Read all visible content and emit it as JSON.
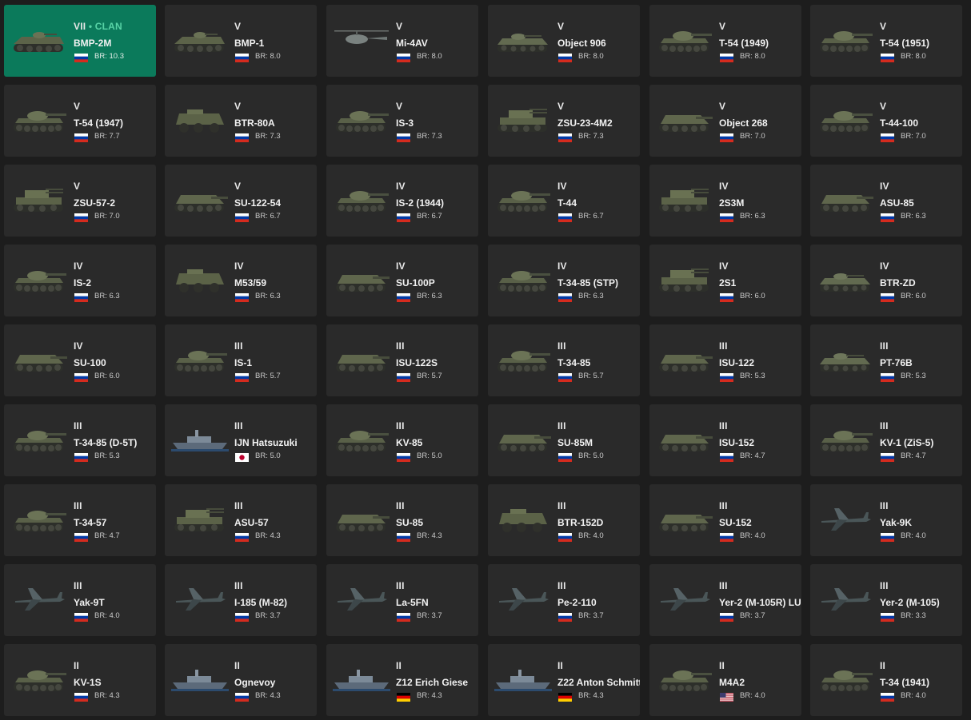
{
  "br_prefix": "BR:",
  "colors": {
    "card_bg": "#2a2a2a",
    "highlight_bg": "#0b7a5b",
    "clan_accent": "#58d3a6",
    "page_bg": "#1d1d1d"
  },
  "vehicles": [
    {
      "rank": "VII",
      "clan_label": "CLAN",
      "name": "BMP-2M",
      "nation": "ussr",
      "br": "10.3",
      "type": "ifv",
      "highlight": true
    },
    {
      "rank": "V",
      "name": "BMP-1",
      "nation": "ussr",
      "br": "8.0",
      "type": "ifv"
    },
    {
      "rank": "V",
      "name": "Mi-4AV",
      "nation": "ussr",
      "br": "8.0",
      "type": "heli"
    },
    {
      "rank": "V",
      "name": "Object 906",
      "nation": "ussr",
      "br": "8.0",
      "type": "light"
    },
    {
      "rank": "V",
      "name": "T-54 (1949)",
      "nation": "ussr",
      "br": "8.0",
      "type": "tank"
    },
    {
      "rank": "V",
      "name": "T-54 (1951)",
      "nation": "ussr",
      "br": "8.0",
      "type": "tank"
    },
    {
      "rank": "V",
      "name": "T-54 (1947)",
      "nation": "ussr",
      "br": "7.7",
      "type": "tank"
    },
    {
      "rank": "V",
      "name": "BTR-80A",
      "nation": "ussr",
      "br": "7.3",
      "type": "wheeled"
    },
    {
      "rank": "V",
      "name": "IS-3",
      "nation": "ussr",
      "br": "7.3",
      "type": "tank"
    },
    {
      "rank": "V",
      "name": "ZSU-23-4M2",
      "nation": "ussr",
      "br": "7.3",
      "type": "spaa"
    },
    {
      "rank": "V",
      "name": "Object 268",
      "nation": "ussr",
      "br": "7.0",
      "type": "td"
    },
    {
      "rank": "V",
      "name": "T-44-100",
      "nation": "ussr",
      "br": "7.0",
      "type": "tank"
    },
    {
      "rank": "V",
      "name": "ZSU-57-2",
      "nation": "ussr",
      "br": "7.0",
      "type": "spaa"
    },
    {
      "rank": "V",
      "name": "SU-122-54",
      "nation": "ussr",
      "br": "6.7",
      "type": "td"
    },
    {
      "rank": "IV",
      "name": "IS-2 (1944)",
      "nation": "ussr",
      "br": "6.7",
      "type": "tank"
    },
    {
      "rank": "IV",
      "name": "T-44",
      "nation": "ussr",
      "br": "6.7",
      "type": "tank"
    },
    {
      "rank": "IV",
      "name": "2S3M",
      "nation": "ussr",
      "br": "6.3",
      "type": "spaa"
    },
    {
      "rank": "IV",
      "name": "ASU-85",
      "nation": "ussr",
      "br": "6.3",
      "type": "td"
    },
    {
      "rank": "IV",
      "name": "IS-2",
      "nation": "ussr",
      "br": "6.3",
      "type": "tank"
    },
    {
      "rank": "IV",
      "name": "M53/59",
      "nation": "ussr",
      "br": "6.3",
      "type": "wheeled"
    },
    {
      "rank": "IV",
      "name": "SU-100P",
      "nation": "ussr",
      "br": "6.3",
      "type": "td"
    },
    {
      "rank": "IV",
      "name": "T-34-85 (STP)",
      "nation": "ussr",
      "br": "6.3",
      "type": "tank"
    },
    {
      "rank": "IV",
      "name": "2S1",
      "nation": "ussr",
      "br": "6.0",
      "type": "spaa"
    },
    {
      "rank": "IV",
      "name": "BTR-ZD",
      "nation": "ussr",
      "br": "6.0",
      "type": "light"
    },
    {
      "rank": "IV",
      "name": "SU-100",
      "nation": "ussr",
      "br": "6.0",
      "type": "td"
    },
    {
      "rank": "III",
      "name": "IS-1",
      "nation": "ussr",
      "br": "5.7",
      "type": "tank"
    },
    {
      "rank": "III",
      "name": "ISU-122S",
      "nation": "ussr",
      "br": "5.7",
      "type": "td"
    },
    {
      "rank": "III",
      "name": "T-34-85",
      "nation": "ussr",
      "br": "5.7",
      "type": "tank"
    },
    {
      "rank": "III",
      "name": "ISU-122",
      "nation": "ussr",
      "br": "5.3",
      "type": "td"
    },
    {
      "rank": "III",
      "name": "PT-76B",
      "nation": "ussr",
      "br": "5.3",
      "type": "light"
    },
    {
      "rank": "III",
      "name": "T-34-85 (D-5T)",
      "nation": "ussr",
      "br": "5.3",
      "type": "tank"
    },
    {
      "rank": "III",
      "name": "IJN Hatsuzuki",
      "nation": "japan",
      "br": "5.0",
      "type": "ship"
    },
    {
      "rank": "III",
      "name": "KV-85",
      "nation": "ussr",
      "br": "5.0",
      "type": "tank"
    },
    {
      "rank": "III",
      "name": "SU-85M",
      "nation": "ussr",
      "br": "5.0",
      "type": "td"
    },
    {
      "rank": "III",
      "name": "ISU-152",
      "nation": "ussr",
      "br": "4.7",
      "type": "td"
    },
    {
      "rank": "III",
      "name": "KV-1 (ZiS-5)",
      "nation": "ussr",
      "br": "4.7",
      "type": "tank"
    },
    {
      "rank": "III",
      "name": "T-34-57",
      "nation": "ussr",
      "br": "4.7",
      "type": "tank"
    },
    {
      "rank": "III",
      "name": "ASU-57",
      "nation": "ussr",
      "br": "4.3",
      "type": "spaa"
    },
    {
      "rank": "III",
      "name": "SU-85",
      "nation": "ussr",
      "br": "4.3",
      "type": "td"
    },
    {
      "rank": "III",
      "name": "BTR-152D",
      "nation": "ussr",
      "br": "4.0",
      "type": "wheeled"
    },
    {
      "rank": "III",
      "name": "SU-152",
      "nation": "ussr",
      "br": "4.0",
      "type": "td"
    },
    {
      "rank": "III",
      "name": "Yak-9K",
      "nation": "ussr",
      "br": "4.0",
      "type": "plane"
    },
    {
      "rank": "III",
      "name": "Yak-9T",
      "nation": "ussr",
      "br": "4.0",
      "type": "plane"
    },
    {
      "rank": "III",
      "name": "I-185 (M-82)",
      "nation": "ussr",
      "br": "3.7",
      "type": "plane"
    },
    {
      "rank": "III",
      "name": "La-5FN",
      "nation": "ussr",
      "br": "3.7",
      "type": "plane"
    },
    {
      "rank": "III",
      "name": "Pe-2-110",
      "nation": "ussr",
      "br": "3.7",
      "type": "plane"
    },
    {
      "rank": "III",
      "name": "Yer-2 (M-105R) LU",
      "nation": "ussr",
      "br": "3.7",
      "type": "plane"
    },
    {
      "rank": "III",
      "name": "Yer-2 (M-105)",
      "nation": "ussr",
      "br": "3.3",
      "type": "plane"
    },
    {
      "rank": "II",
      "name": "KV-1S",
      "nation": "ussr",
      "br": "4.3",
      "type": "tank"
    },
    {
      "rank": "II",
      "name": "Ognevoy",
      "nation": "ussr",
      "br": "4.3",
      "type": "ship"
    },
    {
      "rank": "II",
      "name": "Z12 Erich Giese",
      "nation": "germany",
      "br": "4.3",
      "type": "ship"
    },
    {
      "rank": "II",
      "name": "Z22 Anton Schmitt",
      "nation": "germany",
      "br": "4.3",
      "type": "ship"
    },
    {
      "rank": "II",
      "name": "M4A2",
      "nation": "usa",
      "br": "4.0",
      "type": "tank"
    },
    {
      "rank": "II",
      "name": "T-34 (1941)",
      "nation": "ussr",
      "br": "4.0",
      "type": "tank"
    }
  ]
}
